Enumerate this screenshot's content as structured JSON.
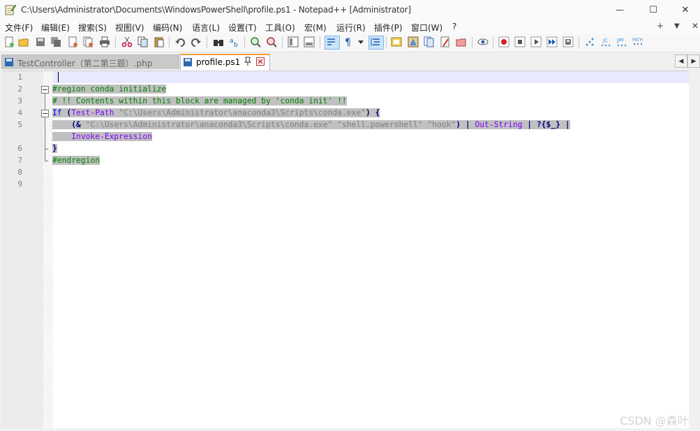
{
  "window": {
    "title": "C:\\Users\\Administrator\\Documents\\WindowsPowerShell\\profile.ps1 - Notepad++ [Administrator]",
    "minimize_glyph": "—",
    "maximize_glyph": "☐",
    "close_glyph": "✕"
  },
  "menu": {
    "items": [
      "文件(F)",
      "编辑(E)",
      "搜索(S)",
      "视图(V)",
      "编码(N)",
      "语言(L)",
      "设置(T)",
      "工具(O)",
      "宏(M)",
      "运行(R)",
      "插件(P)",
      "窗口(W)",
      "?"
    ],
    "right_plus": "+",
    "right_down": "▼",
    "right_close": "✕"
  },
  "toolbar": {
    "icons": [
      "new-file-icon",
      "open-file-icon",
      "save-icon",
      "save-all-icon",
      "close-icon",
      "close-all-icon",
      "print-icon",
      "cut-icon",
      "copy-icon",
      "paste-icon",
      "undo-icon",
      "redo-icon",
      "find-icon",
      "replace-icon",
      "zoom-in-icon",
      "zoom-out-icon",
      "sync-vertical-icon",
      "sync-horizontal-icon",
      "word-wrap-icon",
      "show-all-chars-icon",
      "indent-guide-icon",
      "doc-map-icon",
      "function-list-icon",
      "folder-workspace-icon",
      "doc-list-icon",
      "monitoring-icon",
      "record-macro-icon",
      "stop-record-icon",
      "play-macro-icon",
      "run-macro-multiple-icon",
      "save-macro-icon",
      "plugin-jstool-icon",
      "plugin-jc-icon",
      "plugin-jpf-icon",
      "plugin-path-icon"
    ]
  },
  "tabs": [
    {
      "label": "TestController（第二第三题）.php",
      "active": false
    },
    {
      "label": "profile.ps1",
      "active": true,
      "pin_glyph": "📌",
      "close_glyph": "✕"
    }
  ],
  "editor": {
    "line_numbers": [
      "1",
      "2",
      "3",
      "4",
      "5",
      "",
      "6",
      "7",
      "8",
      "9"
    ],
    "lines": [
      {
        "tokens": []
      },
      {
        "tokens": [
          {
            "t": "#region conda initialize",
            "c": "comment"
          }
        ]
      },
      {
        "tokens": [
          {
            "t": "# !! Contents within this block are managed by 'conda init' !!",
            "c": "comment"
          }
        ]
      },
      {
        "tokens": [
          {
            "t": "If",
            "c": "kw"
          },
          {
            "t": " ",
            "c": "plain"
          },
          {
            "t": "(",
            "c": "op"
          },
          {
            "t": "Test-Path",
            "c": "cmd"
          },
          {
            "t": " ",
            "c": "plain"
          },
          {
            "t": "\"C:\\Users\\Administrator\\anaconda3\\Scripts\\conda.exe\"",
            "c": "str"
          },
          {
            "t": ")",
            "c": "op"
          },
          {
            "t": " ",
            "c": "plain"
          },
          {
            "t": "{",
            "c": "op"
          }
        ]
      },
      {
        "tokens": [
          {
            "t": "    ",
            "c": "plain"
          },
          {
            "t": "(&",
            "c": "op"
          },
          {
            "t": " ",
            "c": "plain"
          },
          {
            "t": "\"C:\\Users\\Administrator\\anaconda3\\Scripts\\conda.exe\"",
            "c": "str"
          },
          {
            "t": " ",
            "c": "plain"
          },
          {
            "t": "\"shell.powershell\"",
            "c": "str"
          },
          {
            "t": " ",
            "c": "plain"
          },
          {
            "t": "\"hook\"",
            "c": "str"
          },
          {
            "t": ")",
            "c": "op"
          },
          {
            "t": " ",
            "c": "plain"
          },
          {
            "t": "|",
            "c": "op"
          },
          {
            "t": " ",
            "c": "plain"
          },
          {
            "t": "Out-String",
            "c": "cmd"
          },
          {
            "t": " ",
            "c": "plain"
          },
          {
            "t": "|",
            "c": "op"
          },
          {
            "t": " ",
            "c": "plain"
          },
          {
            "t": "?{$_}",
            "c": "var"
          },
          {
            "t": " ",
            "c": "plain"
          },
          {
            "t": "|",
            "c": "op"
          }
        ]
      },
      {
        "tokens": [
          {
            "t": "    ",
            "c": "plain"
          },
          {
            "t": "Invoke-Expression",
            "c": "cmd"
          }
        ]
      },
      {
        "tokens": [
          {
            "t": "}",
            "c": "op"
          }
        ]
      },
      {
        "tokens": [
          {
            "t": "#endregion",
            "c": "comment"
          }
        ]
      },
      {
        "tokens": []
      },
      {
        "tokens": []
      }
    ]
  },
  "watermark": "CSDN @森叶",
  "colors": {
    "comment": "#008000",
    "keyword": "#0000ff",
    "cmdlet": "#8000ff",
    "string": "#808080",
    "operator": "#000080",
    "selection": "#c0c0c0",
    "active_tab_accent": "#f39c3c"
  }
}
